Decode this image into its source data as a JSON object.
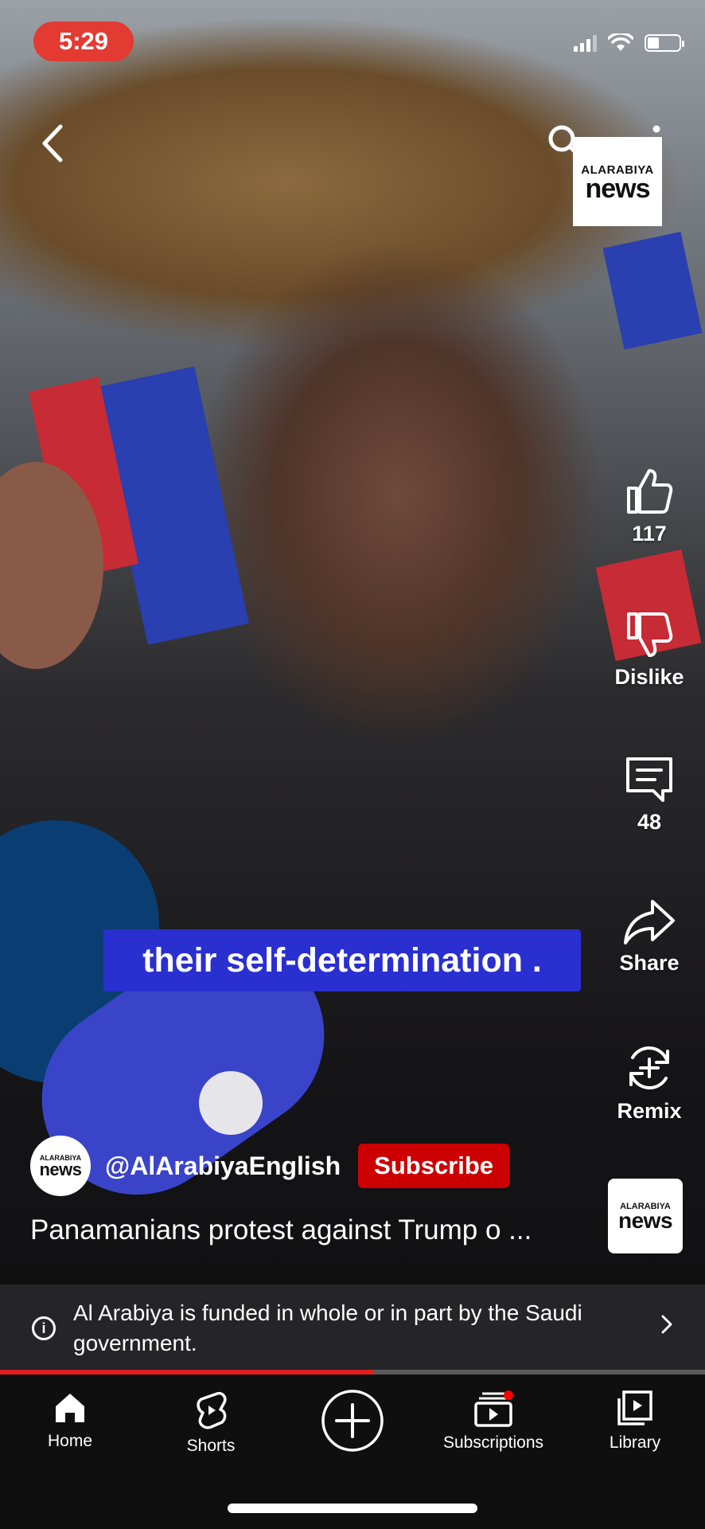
{
  "status_bar": {
    "time": "5:29"
  },
  "overlay_logo": {
    "small": "ALARABIYA",
    "big": "news"
  },
  "actions": {
    "like_count": "117",
    "dislike_label": "Dislike",
    "comments_count": "48",
    "share_label": "Share",
    "remix_label": "Remix"
  },
  "caption": "their self-determination .",
  "channel": {
    "avatar_small": "ALARABIYA",
    "avatar_big": "news",
    "handle": "@AlArabiyaEnglish",
    "subscribe_label": "Subscribe"
  },
  "video_title": "Panamanians protest against Trump o ...",
  "thumb_logo": {
    "small": "ALARABIYA",
    "big": "news"
  },
  "info_notice": "Al Arabiya is funded in whole or in part by the Saudi government.",
  "progress_fraction": 0.53,
  "nav": {
    "home": "Home",
    "shorts": "Shorts",
    "subscriptions": "Subscriptions",
    "library": "Library"
  },
  "colors": {
    "accent_red": "#cc0000",
    "caption_bg": "#2a2fd0",
    "nav_bg": "#0f0f0f"
  }
}
